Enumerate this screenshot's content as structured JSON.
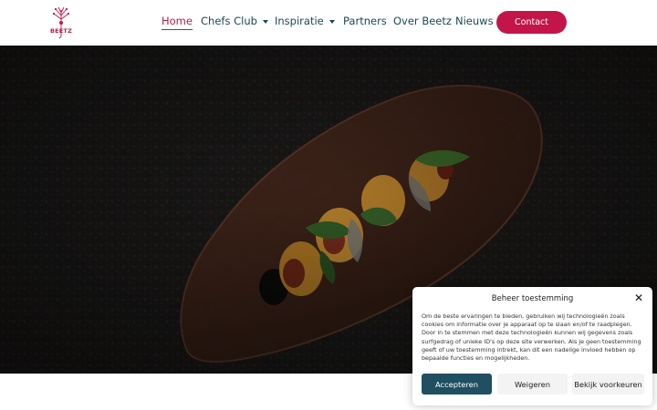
{
  "brand": {
    "logo_text": "BEETZ",
    "accent": "#c4154a",
    "nav_color": "#1c4656"
  },
  "nav": {
    "items": [
      {
        "label": "Home",
        "active": true
      },
      {
        "label": "Chefs Club",
        "dropdown": true
      },
      {
        "label": "Inspiratie",
        "dropdown": true
      },
      {
        "label": "Partners"
      },
      {
        "label": "Over Beetz"
      },
      {
        "label": "Nieuws"
      }
    ],
    "contact_label": "Contact"
  },
  "hero": {
    "image": "plated-dish-on-leaf-shaped-ceramic-plate"
  },
  "cookie": {
    "title": "Beheer toestemming",
    "body": "Om de beste ervaringen te bieden, gebruiken wij technologieën zoals cookies om informatie over je apparaat op te slaan en/of te raadplegen. Door in te stemmen met deze technologieën kunnen wij gegevens zoals surfgedrag of unieke ID's op deze site verwerken. Als je geen toestemming geeft of uw toestemming intrekt, kan dit een nadelige invloed hebben op bepaalde functies en mogelijkheden.",
    "accept_label": "Accepteren",
    "refuse_label": "Weigeren",
    "prefs_label": "Bekijk voorkeuren",
    "accept_color": "#1f4f61"
  }
}
